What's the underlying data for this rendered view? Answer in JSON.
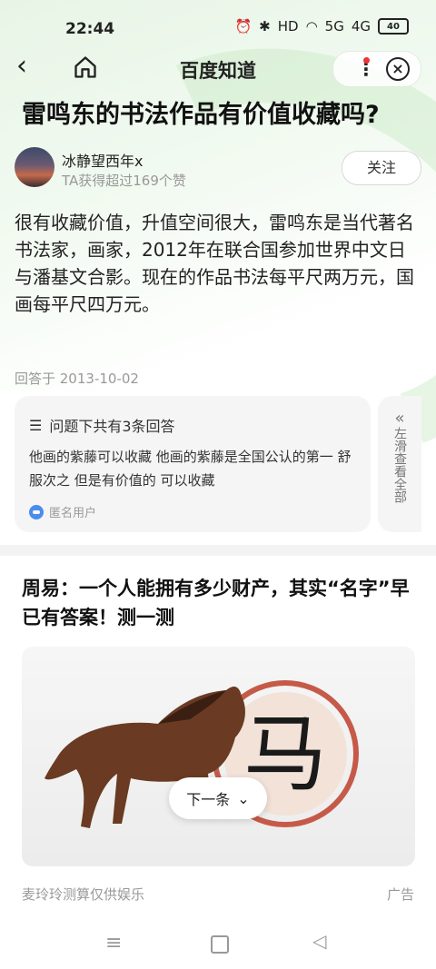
{
  "status": {
    "time": "22:44",
    "icons": [
      "alarm-icon",
      "bluetooth-icon",
      "hd-icon",
      "wifi-icon",
      "5g-signal-icon",
      "4g-signal-icon"
    ],
    "hd": "HD",
    "sig1": "5G",
    "sig2": "4G",
    "battery": "40"
  },
  "nav": {
    "title": "百度知道"
  },
  "question": {
    "title": "雷鸣东的书法作品有价值收藏吗?"
  },
  "author": {
    "name": "冰静望西年x",
    "subtitle": "TA获得超过169个赞",
    "follow_label": "关注"
  },
  "answer": {
    "text": "很有收藏价值，升值空间很大，雷鸣东是当代著名书法家，画家，2012年在联合国参加世界中文日与潘基文合影。现在的作品书法每平尺两万元，国画每平尺四万元。",
    "date": "回答于 2013-10-02"
  },
  "summary": {
    "header": "问题下共有3条回答",
    "text": "他画的紫藤可以收藏 他画的紫藤是全国公认的第一 舒服次之 但是有价值的 可以收藏",
    "user": "匿名用户",
    "side_label": "左滑查看全部"
  },
  "ad": {
    "title": "周易：一个人能拥有多少财产，其实“名字”早已有答案！测一测",
    "image_char": "马",
    "next_label": "下一条",
    "source": "麦玲玲测算仅供娱乐",
    "tag": "广告"
  },
  "colors": {
    "accent_green": "#e8f5e6",
    "red_dot": "#e33333",
    "muted": "#999999"
  }
}
